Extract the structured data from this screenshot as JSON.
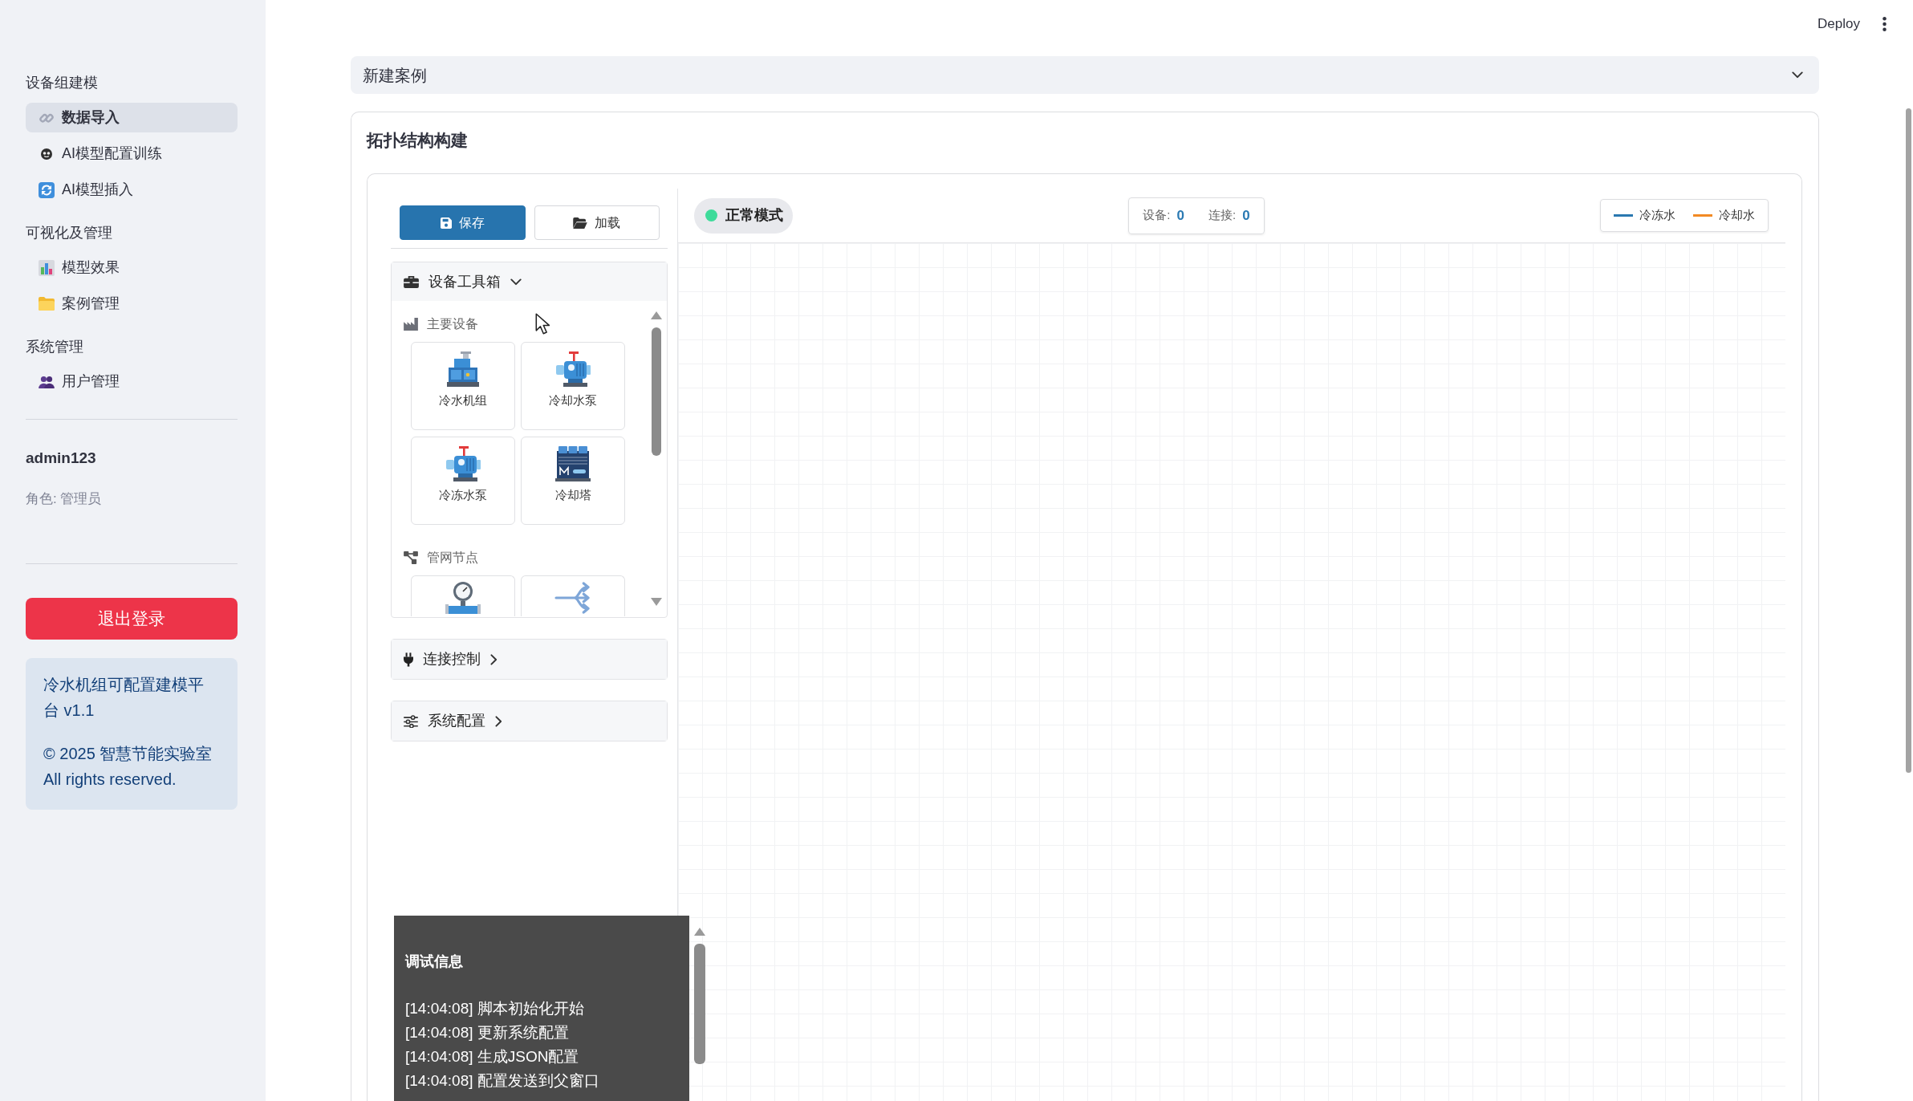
{
  "header": {
    "deploy": "Deploy"
  },
  "sidebar": {
    "sections": [
      {
        "title": "设备组建模",
        "items": [
          {
            "label": "数据导入",
            "selected": true
          },
          {
            "label": "AI模型配置训练",
            "selected": false
          },
          {
            "label": "AI模型插入",
            "selected": false
          }
        ]
      },
      {
        "title": "可视化及管理",
        "items": [
          {
            "label": "模型效果",
            "selected": false
          },
          {
            "label": "案例管理",
            "selected": false
          }
        ]
      },
      {
        "title": "系统管理",
        "items": [
          {
            "label": "用户管理",
            "selected": false
          }
        ]
      }
    ],
    "user": {
      "name": "admin123",
      "role": "角色: 管理员"
    },
    "logout": "退出登录",
    "info": {
      "title": "冷水机组可配置建模平台 v1.1",
      "lines": [
        "© 2025 智慧节能实验室",
        "All rights reserved."
      ]
    }
  },
  "case_expander": {
    "label": "新建案例"
  },
  "topology": {
    "title": "拓扑结构构建",
    "buttons": [
      {
        "label": "保存",
        "kind": "primary"
      },
      {
        "label": "加载",
        "kind": "outline"
      }
    ],
    "panels": [
      {
        "title": "设备工具箱",
        "expanded": true,
        "groups": [
          {
            "title": "主要设备",
            "devices": [
              {
                "label": "冷水机组",
                "kind": "chiller"
              },
              {
                "label": "冷却水泵",
                "kind": "pump"
              },
              {
                "label": "冷冻水泵",
                "kind": "pump"
              },
              {
                "label": "冷却塔",
                "kind": "tower"
              }
            ]
          },
          {
            "title": "管网节点",
            "devices": [
              {
                "kind": "gauge"
              },
              {
                "kind": "splitter"
              }
            ]
          }
        ]
      },
      {
        "title": "连接控制",
        "expanded": false
      },
      {
        "title": "系统配置",
        "expanded": false
      }
    ],
    "mode": {
      "label": "正常模式"
    },
    "stats": [
      {
        "label": "设备:",
        "value": "0"
      },
      {
        "label": "连接:",
        "value": "0"
      }
    ],
    "legend": [
      {
        "label": "冷冻水",
        "color": "#2a78b0"
      },
      {
        "label": "冷却水",
        "color": "#f28a24"
      }
    ],
    "debug": {
      "title": "调试信息",
      "lines": [
        "[14:04:08] 脚本初始化开始",
        "[14:04:08] 更新系统配置",
        "[14:04:08] 生成JSON配置",
        "[14:04:08] 配置发送到父窗口"
      ]
    }
  }
}
